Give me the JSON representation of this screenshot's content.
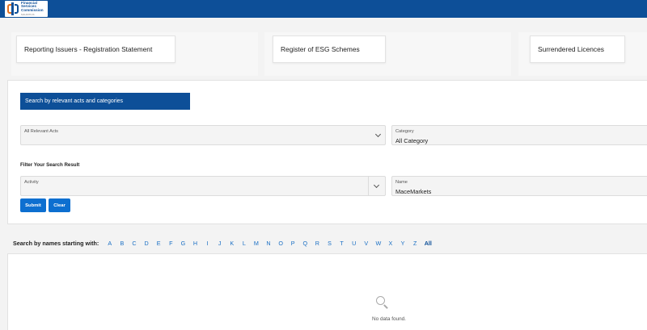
{
  "header": {
    "logo_line1": "Financial",
    "logo_line2": "Services",
    "logo_line3": "Commission",
    "logo_line4": "MAURITIUS",
    "brand_color": "#0d4f98",
    "accent_color": "#e4701e"
  },
  "cards": [
    {
      "label": "Reporting Issuers - Registration Statement"
    },
    {
      "label": "Register of ESG Schemes"
    },
    {
      "label": "Surrendered Licences"
    }
  ],
  "search": {
    "banner": "Search by relevant acts and categories",
    "acts": {
      "label": "All Relevant Acts",
      "value": ""
    },
    "category": {
      "label": "Category",
      "value": "All Category"
    },
    "filter_title": "Filter Your Search Result",
    "activity": {
      "label": "Activity",
      "value": ""
    },
    "name": {
      "label": "Name",
      "value": "MaceMarkets"
    },
    "submit_label": "Submit",
    "clear_label": "Clear"
  },
  "alphabet": {
    "label": "Search by names starting with:",
    "letters": [
      "A",
      "B",
      "C",
      "D",
      "E",
      "F",
      "G",
      "H",
      "I",
      "J",
      "K",
      "L",
      "M",
      "N",
      "O",
      "P",
      "Q",
      "R",
      "S",
      "T",
      "U",
      "V",
      "W",
      "X",
      "Y",
      "Z",
      "All"
    ],
    "active": "All"
  },
  "results": {
    "empty_text": "No data found."
  }
}
